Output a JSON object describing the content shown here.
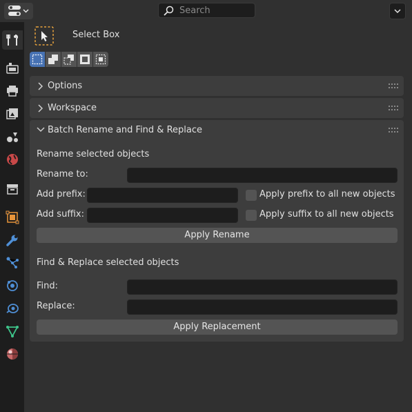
{
  "header": {
    "search_placeholder": "Search"
  },
  "tool": {
    "name": "Select Box"
  },
  "selection_modes": [
    {
      "icon": "mode-new-icon",
      "active": true
    },
    {
      "icon": "mode-extend-icon",
      "active": false
    },
    {
      "icon": "mode-subtract-icon",
      "active": false
    },
    {
      "icon": "mode-invert-icon",
      "active": false
    },
    {
      "icon": "mode-intersect-icon",
      "active": false
    }
  ],
  "sidebar_tabs": [
    "tool-icon",
    "render-icon",
    "output-icon",
    "view-layer-icon",
    "scene-icon",
    "world-icon",
    "collection-icon",
    "object-icon",
    "modifiers-icon",
    "particles-icon",
    "physics-icon",
    "constraints-icon",
    "data-icon",
    "material-icon"
  ],
  "panels": {
    "options": {
      "title": "Options"
    },
    "workspace": {
      "title": "Workspace"
    },
    "batch": {
      "title": "Batch Rename and Find & Replace",
      "rename_section": "Rename selected objects",
      "rename_to_label": "Rename to:",
      "rename_to_value": "",
      "add_prefix_label": "Add prefix:",
      "add_prefix_value": "",
      "apply_prefix_label": "Apply prefix to all new objects",
      "add_suffix_label": "Add suffix:",
      "add_suffix_value": "",
      "apply_suffix_label": "Apply suffix to all new objects",
      "apply_rename": "Apply Rename",
      "replace_section": "Find & Replace selected objects",
      "find_label": "Find:",
      "find_value": "",
      "replace_label": "Replace:",
      "replace_value": "",
      "apply_replacement": "Apply Replacement"
    }
  },
  "colors": {
    "accent": "#4772b3",
    "tool_outline": "#e8a33d"
  }
}
